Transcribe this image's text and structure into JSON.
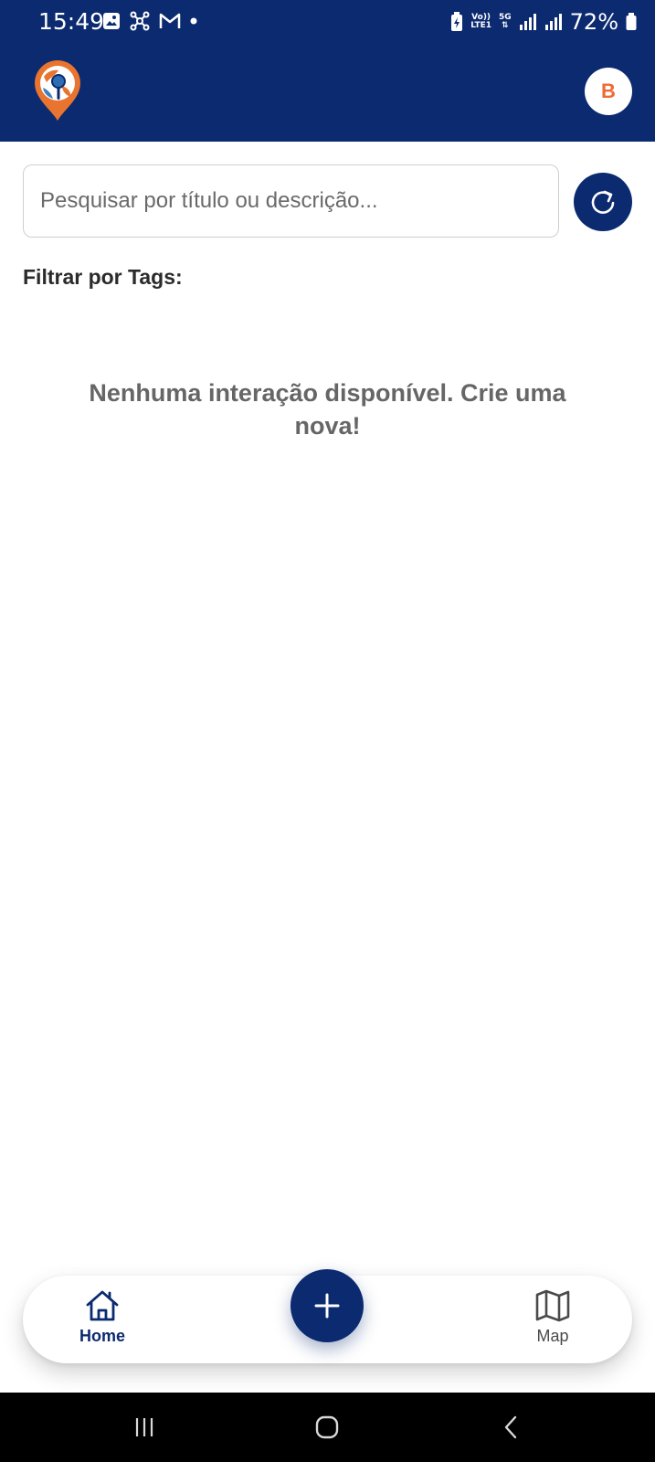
{
  "status_bar": {
    "time": "15:49",
    "battery": "72%",
    "network_top": "Vo))",
    "network_bottom": "LTE1",
    "network_gen": "5G"
  },
  "header": {
    "avatar_initial": "B",
    "logo_icon": "globe-pin-logo",
    "colors": {
      "primary": "#0b2a6f",
      "accent": "#ef6a32"
    }
  },
  "search": {
    "placeholder": "Pesquisar por título ou descrição...",
    "value": "",
    "refresh_icon": "refresh-icon"
  },
  "filters": {
    "title": "Filtrar por Tags:"
  },
  "empty_state": {
    "message": "Nenhuma interação disponível. Crie uma nova!"
  },
  "bottom_nav": {
    "items": [
      {
        "label": "Home",
        "icon": "home-icon",
        "active": true
      },
      {
        "label": "Map",
        "icon": "map-icon",
        "active": false
      }
    ],
    "fab_icon": "plus-icon"
  }
}
